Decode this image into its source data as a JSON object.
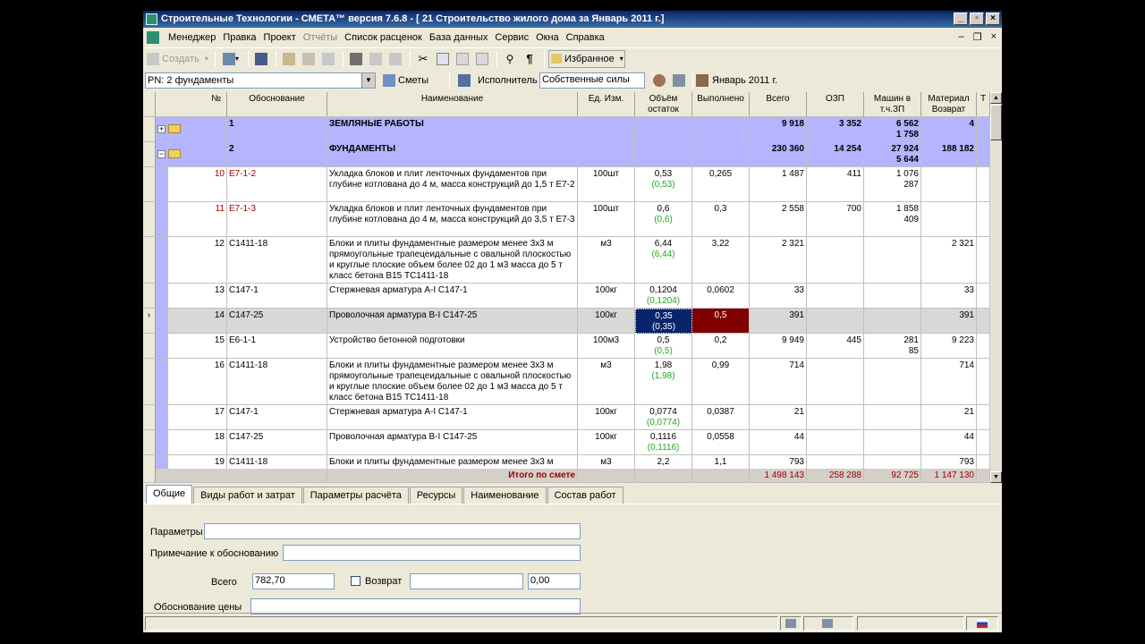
{
  "window": {
    "title": "Строительные Технологии - СМЕТА™ версия 7.6.8 - [  21  Строительство жилого дома за Январь 2011 г.]"
  },
  "menu": [
    "Менеджер",
    "Правка",
    "Проект",
    "Отчёты",
    "Список расценок",
    "База данных",
    "Сервис",
    "Окна",
    "Справка"
  ],
  "toolbar": {
    "create_label": "Создать",
    "favorites_label": "Избранное"
  },
  "toolbar2": {
    "section_value": "РN: 2 фундаменты",
    "estimates_label": "Сметы",
    "executor_label": "Исполнитель",
    "executor_value": "Собственные силы",
    "period_label": "Январь 2011 г."
  },
  "grid": {
    "headers": [
      "№",
      "Обоснование",
      "Наименование",
      "Ед. Изм.",
      "Объём остаток",
      "Выполнено",
      "Всего",
      "ОЗП",
      "Машин в т.ч.ЗП",
      "Материал Возврат",
      "Т"
    ],
    "sections": [
      {
        "num": "1",
        "name": "ЗЕМЛЯНЫЕ РАБОТЫ",
        "total": "9 918",
        "ozp": "3 352",
        "mach": "6 562",
        "mach2": "1 758",
        "mat": "4",
        "expander": "+"
      },
      {
        "num": "2",
        "name": "ФУНДАМЕНТЫ",
        "total": "230 360",
        "ozp": "14 254",
        "mach": "27 924",
        "mach2": "5 644",
        "mat": "188 182",
        "expander": "−"
      }
    ],
    "rows": [
      {
        "n": "10",
        "code": "Е7-1-2",
        "name": "Укладка блоков и плит ленточных фундаментов при глубине котлована до 4 м, масса конструкций до 1,5 т Е7-2",
        "unit": "100шт",
        "vol": "0,53",
        "vol2": "(0,53)",
        "done": "0,265",
        "total": "1 487",
        "ozp": "411",
        "mach": "1 076",
        "mach2": "287",
        "mat": ""
      },
      {
        "n": "11",
        "code": "Е7-1-3",
        "name": "Укладка блоков и плит ленточных фундаментов при глубине котлована до 4 м, масса конструкций до 3,5 т Е7-3",
        "unit": "100шт",
        "vol": "0,6",
        "vol2": "(0,6)",
        "done": "0,3",
        "total": "2 558",
        "ozp": "700",
        "mach": "1 858",
        "mach2": "409",
        "mat": ""
      },
      {
        "n": "12",
        "code": "С1411-18",
        "name": "Блоки и плиты фундаментные размером менее 3х3 м прямоугольные трапецеидальные с овальной плоскостью и круглые плоские объем более 02 до 1 м3 масса до 5 т класс бетона В15 ТС1411-18",
        "unit": "м3",
        "vol": "6,44",
        "vol2": "(6,44)",
        "done": "3,22",
        "total": "2 321",
        "ozp": "",
        "mach": "",
        "mach2": "",
        "mat": "2 321"
      },
      {
        "n": "13",
        "code": "С147-1",
        "name": "Стержневая арматура А-I С147-1",
        "unit": "100кг",
        "vol": "0,1204",
        "vol2": "(0,1204)",
        "done": "0,0602",
        "total": "33",
        "ozp": "",
        "mach": "",
        "mach2": "",
        "mat": "33"
      },
      {
        "n": "14",
        "code": "С147-25",
        "name": "Проволочная арматура В-I С147-25",
        "unit": "100кг",
        "vol": "0,35",
        "vol2": "(0,35)",
        "done": "0,5",
        "total": "391",
        "ozp": "",
        "mach": "",
        "mach2": "",
        "mat": "391"
      },
      {
        "n": "15",
        "code": "Е6-1-1",
        "name": "Устройство бетонной подготовки",
        "unit": "100м3",
        "vol": "0,5",
        "vol2": "(0,5)",
        "done": "0,2",
        "total": "9 949",
        "ozp": "445",
        "mach": "281",
        "mach2": "85",
        "mat": "9 223"
      },
      {
        "n": "16",
        "code": "С1411-18",
        "name": "Блоки и плиты фундаментные размером менее 3х3 м прямоугольные трапецеидальные с овальной плоскостью и круглые плоские объем более 02 до 1 м3 масса до 5 т класс бетона В15 ТС1411-18",
        "unit": "м3",
        "vol": "1,98",
        "vol2": "(1,98)",
        "done": "0,99",
        "total": "714",
        "ozp": "",
        "mach": "",
        "mach2": "",
        "mat": "714"
      },
      {
        "n": "17",
        "code": "С147-1",
        "name": "Стержневая арматура А-I С147-1",
        "unit": "100кг",
        "vol": "0,0774",
        "vol2": "(0,0774)",
        "done": "0,0387",
        "total": "21",
        "ozp": "",
        "mach": "",
        "mach2": "",
        "mat": "21"
      },
      {
        "n": "18",
        "code": "С147-25",
        "name": "Проволочная арматура В-I С147-25",
        "unit": "100кг",
        "vol": "0,1116",
        "vol2": "(0,1116)",
        "done": "0,0558",
        "total": "44",
        "ozp": "",
        "mach": "",
        "mach2": "",
        "mat": "44"
      },
      {
        "n": "19",
        "code": "С1411-18",
        "name": "Блоки и плиты фундаментные размером менее 3х3 м",
        "unit": "м3",
        "vol": "2,2",
        "vol2": "",
        "done": "1,1",
        "total": "793",
        "ozp": "",
        "mach": "",
        "mach2": "",
        "mat": "793"
      }
    ],
    "totals": {
      "label": "Итого по смете",
      "total": "1 498 143",
      "ozp": "258 288",
      "mach": "92 725",
      "mat": "1 147 130"
    }
  },
  "tabs": [
    "Общие",
    "Виды работ и затрат",
    "Параметры расчёта",
    "Ресурсы",
    "Наименование",
    "Состав работ"
  ],
  "form": {
    "params_label": "Параметры",
    "params_value": "",
    "note_label": "Примечание к обоснованию",
    "note_value": "",
    "total_label": "Всего",
    "total_value": "782,70",
    "return_label": "Возврат",
    "return_value": "",
    "return_amount": "0,00",
    "price_basis_label": "Обоснование цены",
    "price_basis_value": ""
  }
}
